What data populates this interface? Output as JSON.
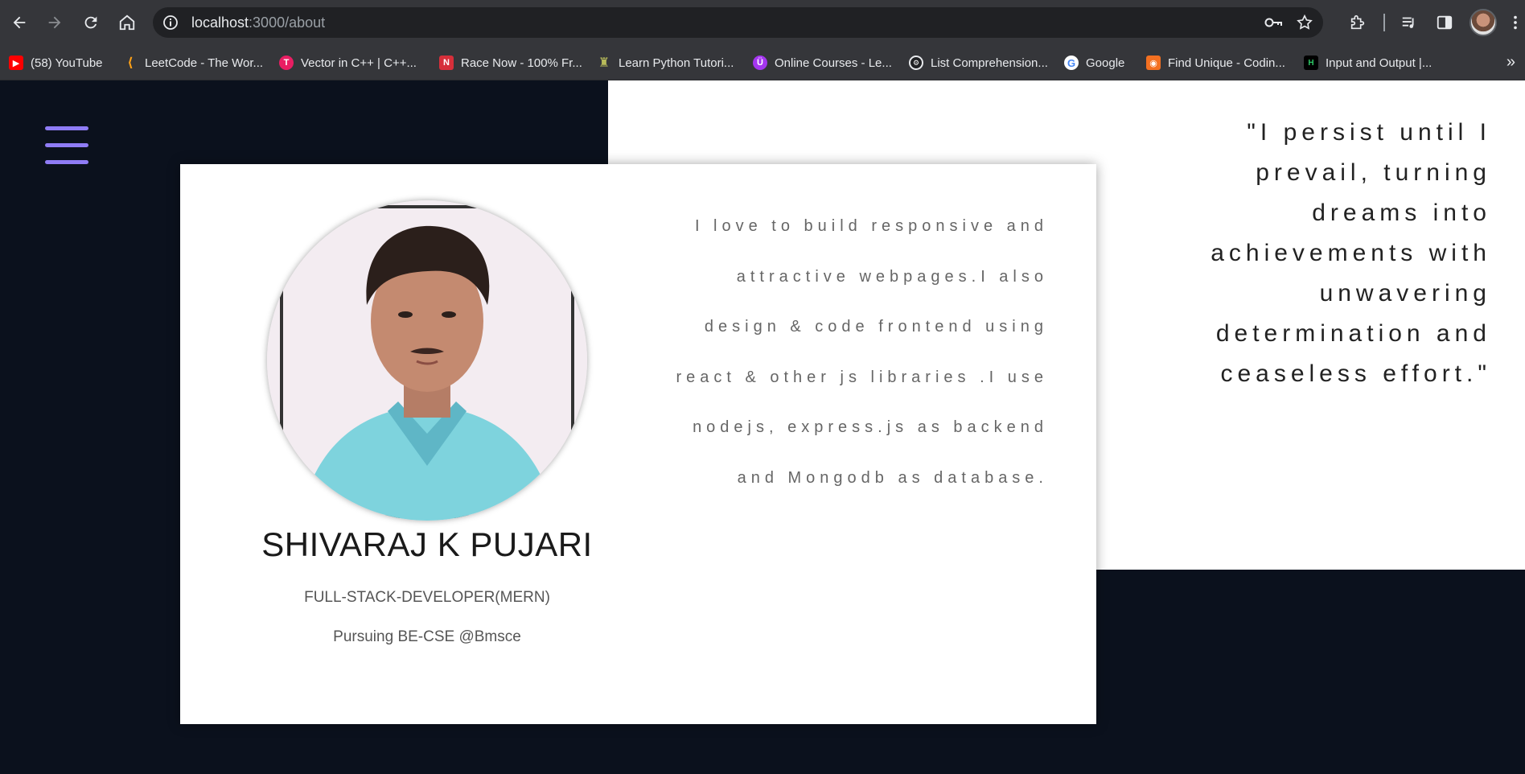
{
  "browser": {
    "url_host": "localhost",
    "url_path": ":3000/about",
    "bookmarks": [
      {
        "label": "(58) YouTube",
        "icon": "youtube-icon",
        "color": "#ff0000"
      },
      {
        "label": "LeetCode - The Wor...",
        "icon": "leetcode-icon",
        "color": "#ffa116"
      },
      {
        "label": "Vector in C++ | C++...",
        "icon": "tpoint-icon",
        "color": "#e91e63"
      },
      {
        "label": "Race Now - 100% Fr...",
        "icon": "nitrotype-icon",
        "color": "#d62f3a"
      },
      {
        "label": "Learn Python Tutori...",
        "icon": "python-tutorial-icon",
        "color": "#8a8d3a"
      },
      {
        "label": "Online Courses - Le...",
        "icon": "udemy-icon",
        "color": "#a435f0"
      },
      {
        "label": "List Comprehension...",
        "icon": "gear-site-icon",
        "color": "#202124"
      },
      {
        "label": "Google",
        "icon": "google-icon",
        "color": "#ffffff"
      },
      {
        "label": "Find Unique - Codin...",
        "icon": "codingninjas-icon",
        "color": "#f37021"
      },
      {
        "label": "Input and Output |...",
        "icon": "hackerrank-icon",
        "color": "#000000"
      }
    ]
  },
  "page": {
    "quote": "\"I persist until I prevail, turning dreams into achievements with unwavering determination and ceaseless effort.\"",
    "profile": {
      "name": "SHIVARAJ K PUJARI",
      "role": "FULL-STACK-DEVELOPER(MERN)",
      "education": "Pursuing BE-CSE @Bmsce",
      "about": "I love to build responsive and attractive webpages.I also design & code frontend using react & other js libraries .I use nodejs, express.js as backend and Mongodb as database."
    },
    "colors": {
      "accent": "#8f7cf5",
      "background": "#0b111d",
      "panel": "#ffffff"
    }
  }
}
